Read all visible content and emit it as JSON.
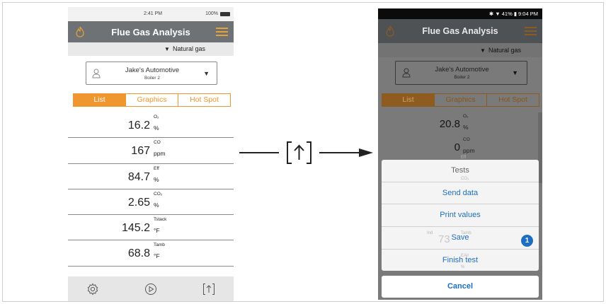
{
  "left_phone": {
    "status": {
      "time": "2:41 PM",
      "battery": "100%"
    },
    "header": {
      "title": "Flue Gas Analysis"
    },
    "fuel": {
      "label": "Natural gas"
    },
    "customer": {
      "name": "Jake's Automotive",
      "location": "Boiler 2"
    },
    "tabs": [
      {
        "label": "List"
      },
      {
        "label": "Graphics"
      },
      {
        "label": "Hot Spot"
      }
    ],
    "readings": [
      {
        "value": "16.2",
        "param": "O₂",
        "unit": "%"
      },
      {
        "value": "167",
        "param": "CO",
        "unit": "ppm"
      },
      {
        "value": "84.7",
        "param": "Eff",
        "unit": "%"
      },
      {
        "value": "2.65",
        "param": "CO₂",
        "unit": "%"
      },
      {
        "value": "145.2",
        "param": "Tstack",
        "unit": "°F"
      },
      {
        "value": "68.8",
        "param": "Tamb",
        "unit": "°F"
      }
    ],
    "footer_icons": [
      "gear-icon",
      "play-icon",
      "share-icon"
    ]
  },
  "right_phone": {
    "status": {
      "indicators": "✱ ▼ 41% ▮ 9:04 PM"
    },
    "header": {
      "title": "Flue Gas Analysis"
    },
    "fuel": {
      "label": "Natural gas"
    },
    "customer": {
      "name": "Jake's Automotive",
      "location": "Boiler 2"
    },
    "tabs": [
      {
        "label": "List"
      },
      {
        "label": "Graphics"
      },
      {
        "label": "Hot Spot"
      }
    ],
    "readings": [
      {
        "value": "20.8",
        "param": "O₂",
        "unit": "%"
      },
      {
        "value": "0",
        "param": "CO",
        "unit": "ppm"
      }
    ],
    "sheet": {
      "header": "Tests",
      "items": [
        "Send data",
        "Print values",
        "Save",
        "Finish test"
      ],
      "cancel": "Cancel",
      "badge": "1",
      "ghost_value": "73",
      "ghost_labels": {
        "eff": "Eff",
        "co2": "CO₂",
        "tamb": "Tamb",
        "ind": "Ind",
        "eair": "EAir",
        "pct": "%"
      }
    }
  },
  "colors": {
    "accent": "#f0962e",
    "header": "#6e7275",
    "link": "#1c6fc1"
  }
}
